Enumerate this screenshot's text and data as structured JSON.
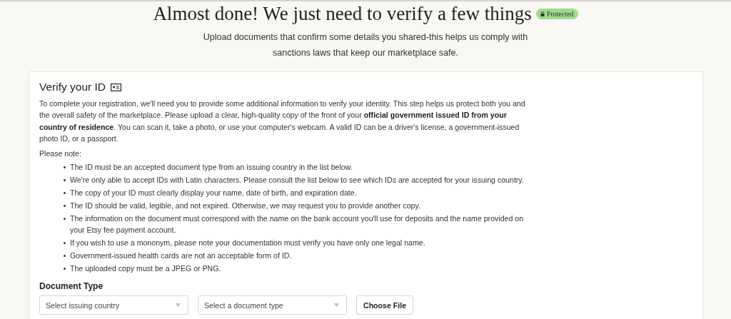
{
  "header": {
    "title": "Almost done! We just need to verify a few things",
    "badge": "Protected",
    "subtitle": "Upload documents that confirm some details you shared-this helps us comply with sanctions laws that keep our marketplace safe."
  },
  "card": {
    "title": "Verify your ID",
    "intro": "To complete your registration, we'll need you to provide some additional information to verify your identity. This step helps us protect both you and the overall safety of the marketplace. Please upload a clear, high-quality copy of the front of your **official government issued ID from your country of residence**. You can scan it, take a photo, or use your computer's webcam. A valid ID can be a driver's license, a government-issued photo ID, or a passport.",
    "note_label": "Please note:",
    "notes": [
      "The ID must be an accepted document type from an issuing country in the list below.",
      "We're only able to accept IDs with Latin characters. Please consult the list below to see which IDs are accepted for your issuing country.",
      "The copy of your ID must clearly display your name, date of birth, and expiration date.",
      "The ID should be valid, legible, and not expired. Otherwise, we may request you to provide another copy.",
      "The information on the document must correspond with the name on the bank account you'll use for deposits and the name provided on your Etsy fee payment account.",
      "If you wish to use a mononym, please note your documentation must verify you have only one legal name.",
      "Government-issued health cards are not an acceptable form of ID.",
      "The uploaded copy must be a JPEG or PNG."
    ],
    "document_type": {
      "label": "Document Type",
      "country_select": {
        "placeholder": "Select issuing country"
      },
      "type_select": {
        "placeholder": "Select a document type"
      },
      "file_button": "Choose File"
    }
  }
}
